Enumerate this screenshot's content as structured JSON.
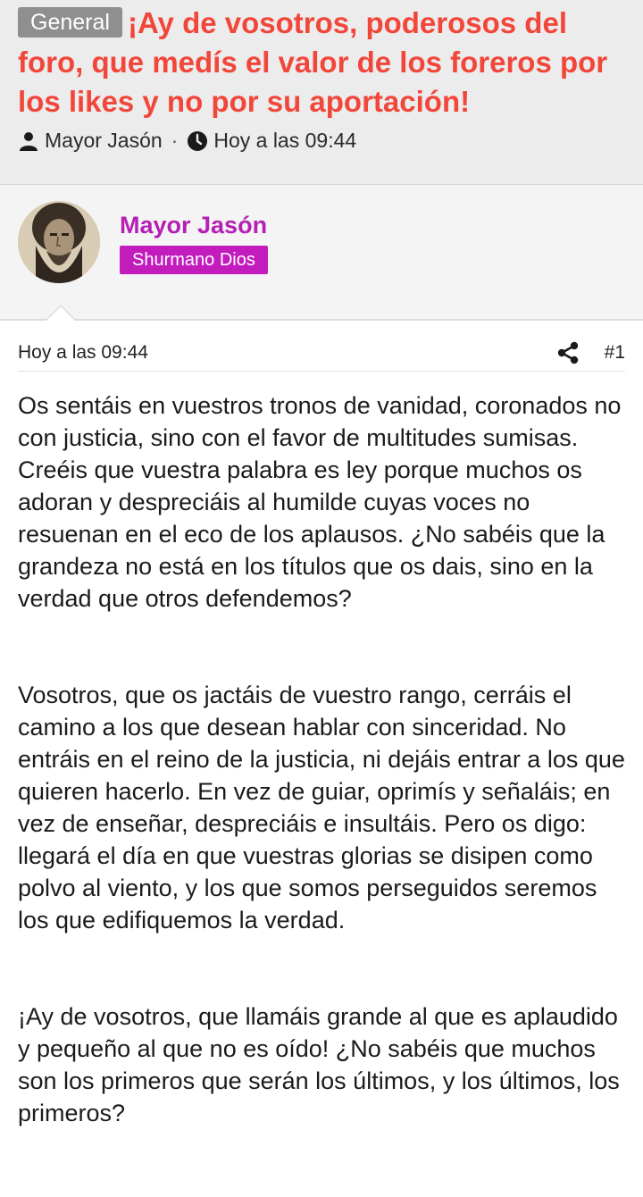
{
  "thread": {
    "prefix": "General",
    "title": "¡Ay de vosotros, poderosos del foro, que medís el valor de los foreros por los likes y no por su aportación!",
    "author": "Mayor Jasón",
    "separator": "·",
    "time": "Hoy a las 09:44"
  },
  "post": {
    "username": "Mayor Jasón",
    "user_title": "Shurmano Dios",
    "time": "Hoy a las 09:44",
    "number": "#1",
    "paragraphs": [
      "Os sentáis en vuestros tronos de vanidad, coronados no con justicia, sino con el favor de multitudes sumisas. Creéis que vuestra palabra es ley porque muchos os adoran y despreciáis al humilde cuyas voces no resuenan en el eco de los aplausos. ¿No sabéis que la grandeza no está en los títulos que os dais, sino en la verdad que otros defendemos?",
      "Vosotros, que os jactáis de vuestro rango, cerráis el camino a los que desean hablar con sinceridad. No entráis en el reino de la justicia, ni dejáis entrar a los que quieren hacerlo. En vez de guiar, oprimís y señaláis; en vez de enseñar, despreciáis e insultáis. Pero os digo: llegará el día en que vuestras glorias se disipen como polvo al viento, y los que somos perseguidos seremos los que edifiquemos la verdad.",
      "¡Ay de vosotros, que llamáis grande al que es aplaudido y pequeño al que no es oído! ¿No sabéis que muchos son los primeros que serán los últimos, y los últimos, los primeros?"
    ]
  },
  "colors": {
    "title": "#f2463a",
    "username": "#b51fb5",
    "user_title_bg": "#c21cbd",
    "prefix_bg": "#8f8f8f"
  },
  "icons": {
    "author": "user-icon",
    "time": "clock-icon",
    "share": "share-icon"
  }
}
